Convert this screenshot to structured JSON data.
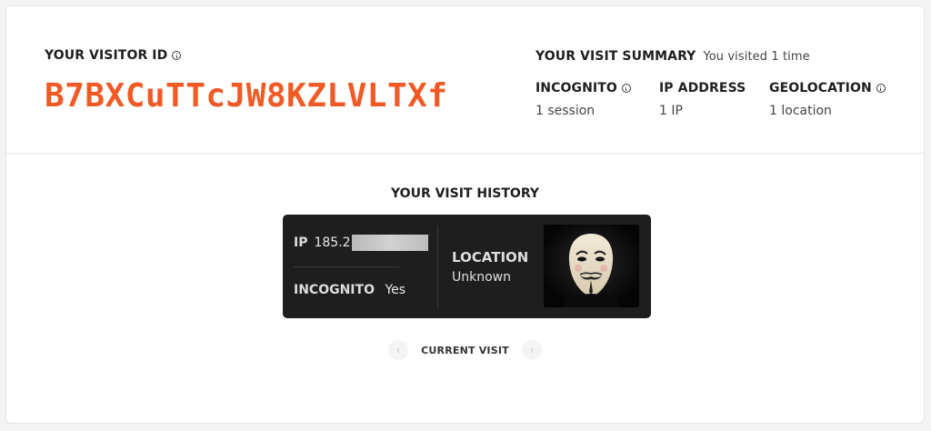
{
  "visitor": {
    "label": "YOUR VISITOR ID",
    "id": "B7BXCuTTcJW8KZLVLTXf",
    "accent": "#f15a24"
  },
  "summary": {
    "title": "YOUR VISIT SUMMARY",
    "subtitle": "You visited 1 time",
    "stats": [
      {
        "label": "INCOGNITO",
        "value": "1 session",
        "icon": "info-icon"
      },
      {
        "label": "IP ADDRESS",
        "value": "1 IP"
      },
      {
        "label": "GEOLOCATION",
        "value": "1 location",
        "icon": "info-icon"
      }
    ]
  },
  "history": {
    "title": "YOUR VISIT HISTORY",
    "card": {
      "ip_label": "IP",
      "ip_value": "185.2",
      "incognito_label": "INCOGNITO",
      "incognito_value": "Yes",
      "location_label": "LOCATION",
      "location_value": "Unknown",
      "avatar": "anonymous-mask-image"
    },
    "nav": {
      "prev_icon": "chevron-left-icon",
      "label": "CURRENT VISIT",
      "next_icon": "chevron-right-icon"
    }
  }
}
